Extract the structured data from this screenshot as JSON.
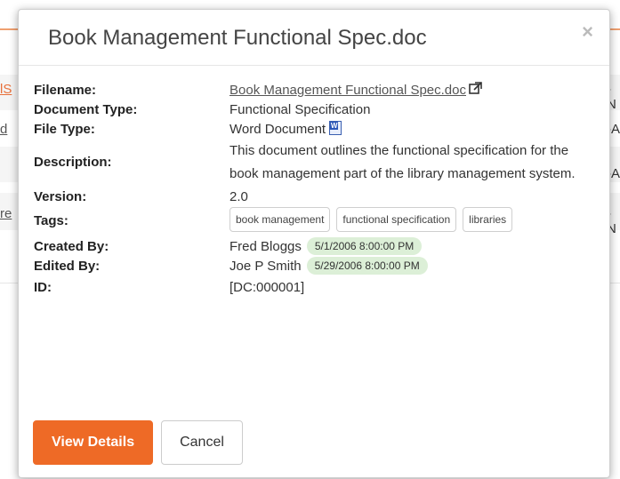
{
  "modal": {
    "title": "Book Management Functional Spec.doc",
    "close_glyph": "×"
  },
  "fields": {
    "filename_label": "Filename:",
    "filename_value": "Book Management Functional Spec.doc",
    "doctype_label": "Document Type:",
    "doctype_value": "Functional Specification",
    "filetype_label": "File Type:",
    "filetype_value": "Word Document",
    "description_label": "Description:",
    "description_value": "This document outlines the functional specification for the book management part of the library management system.",
    "version_label": "Version:",
    "version_value": "2.0",
    "tags_label": "Tags:",
    "tags": [
      "book management",
      "functional specification",
      "libraries"
    ],
    "createdby_label": "Created By:",
    "createdby_value": "Fred Bloggs",
    "createdby_date": "5/1/2006 8:00:00 PM",
    "editedby_label": "Edited By:",
    "editedby_value": "Joe P Smith",
    "editedby_date": "5/29/2006 8:00:00 PM",
    "id_label": "ID:",
    "id_value": "[DC:000001]"
  },
  "footer": {
    "view_details_label": "View Details",
    "cancel_label": "Cancel"
  },
  "colors": {
    "accent": "#ee6a26",
    "badge_bg": "#dcefd7"
  }
}
